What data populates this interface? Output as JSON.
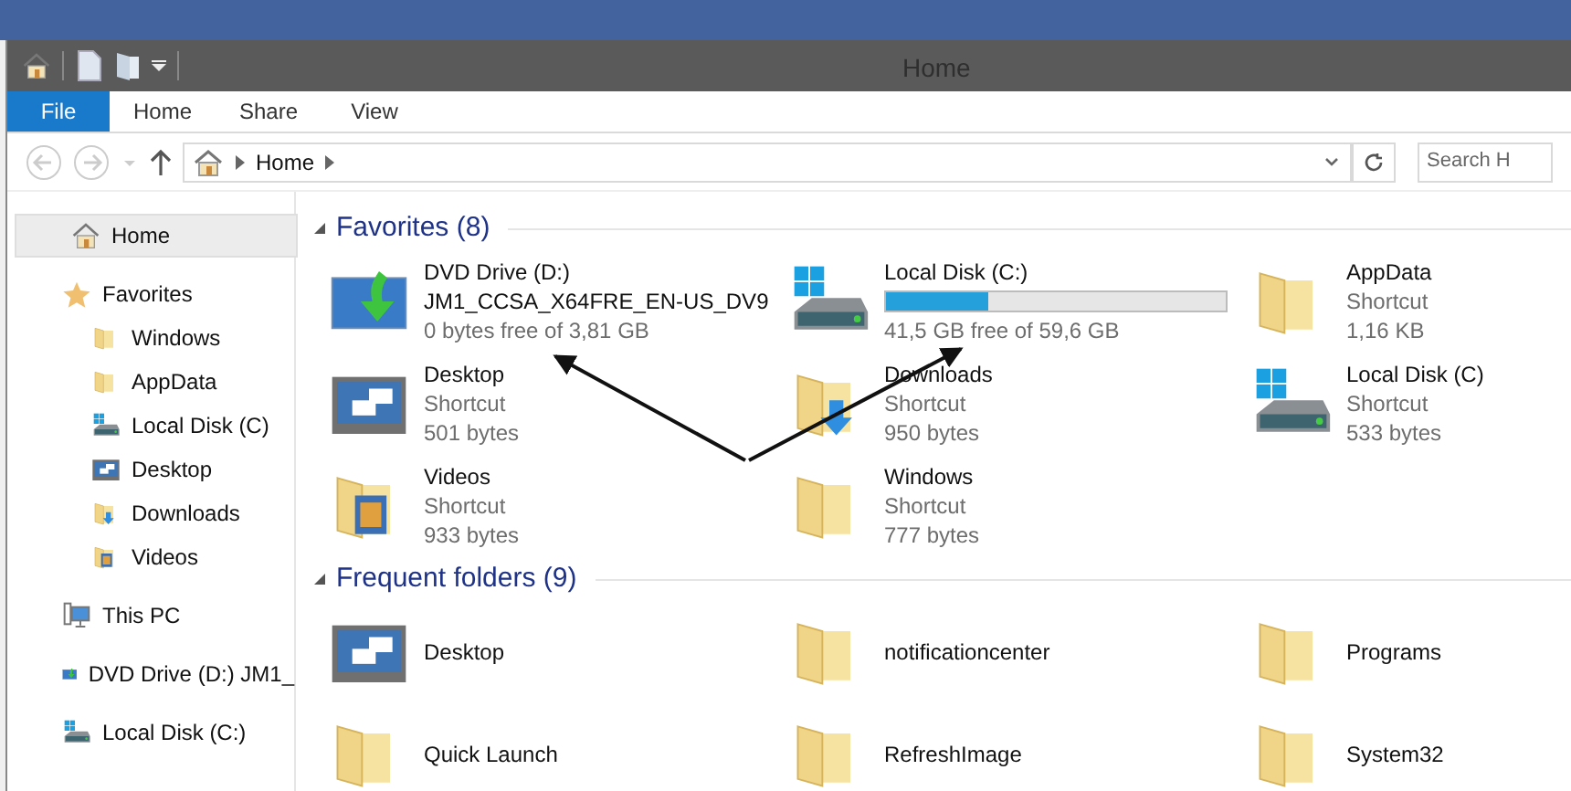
{
  "window": {
    "title": "Home"
  },
  "ribbon": {
    "tabs": [
      {
        "label": "File",
        "selected": true
      },
      {
        "label": "Home",
        "selected": false
      },
      {
        "label": "Share",
        "selected": false
      },
      {
        "label": "View",
        "selected": false
      }
    ]
  },
  "address_bar": {
    "path": [
      "Home"
    ],
    "search": {
      "placeholder": "Search H"
    }
  },
  "sidebar": {
    "items": [
      {
        "label": "Home",
        "kind": "home",
        "selected": true
      },
      {
        "label": "Favorites",
        "kind": "star",
        "selected": false,
        "children": [
          {
            "label": "Windows",
            "kind": "folder",
            "selected": false
          },
          {
            "label": "AppData",
            "kind": "folder",
            "selected": false
          },
          {
            "label": "Local Disk (C)",
            "kind": "disk",
            "selected": false
          },
          {
            "label": "Desktop",
            "kind": "screen",
            "selected": false
          },
          {
            "label": "Downloads",
            "kind": "download",
            "selected": false
          },
          {
            "label": "Videos",
            "kind": "video",
            "selected": false
          }
        ]
      },
      {
        "label": "This PC",
        "kind": "pc",
        "selected": false
      },
      {
        "label": "DVD Drive (D:) JM1_",
        "kind": "dvd",
        "selected": false
      },
      {
        "label": "Local Disk (C:)",
        "kind": "disk",
        "selected": false
      }
    ]
  },
  "groups": [
    {
      "title": "Favorites (8)",
      "items": [
        {
          "kind": "dvd",
          "lines": [
            "DVD Drive (D:)",
            "JM1_CCSA_X64FRE_EN-US_DV9",
            "0 bytes free of 3,81 GB"
          ]
        },
        {
          "kind": "disk",
          "lines": [
            "Local Disk (C:)",
            "41,5 GB free of 59,6 GB"
          ],
          "level": 0.3
        },
        {
          "kind": "folder",
          "lines": [
            "AppData",
            "Shortcut",
            "1,16 KB"
          ]
        },
        {
          "kind": "screen",
          "lines": [
            "Desktop",
            "Shortcut",
            "501 bytes"
          ]
        },
        {
          "kind": "download",
          "lines": [
            "Downloads",
            "Shortcut",
            "950 bytes"
          ]
        },
        {
          "kind": "disk",
          "lines": [
            "Local Disk (C)",
            "Shortcut",
            "533 bytes"
          ]
        },
        {
          "kind": "video",
          "lines": [
            "Videos",
            "Shortcut",
            "933 bytes"
          ]
        },
        {
          "kind": "folder",
          "lines": [
            "Windows",
            "Shortcut",
            "777 bytes"
          ]
        }
      ]
    },
    {
      "title": "Frequent folders (9)",
      "items": [
        {
          "kind": "screen",
          "lines": [
            "Desktop"
          ]
        },
        {
          "kind": "folder",
          "lines": [
            "notificationcenter"
          ]
        },
        {
          "kind": "folder",
          "lines": [
            "Programs"
          ]
        },
        {
          "kind": "folder",
          "lines": [
            "Quick Launch"
          ]
        },
        {
          "kind": "folder",
          "lines": [
            "RefreshImage"
          ]
        },
        {
          "kind": "folder",
          "lines": [
            "System32"
          ]
        }
      ]
    }
  ]
}
